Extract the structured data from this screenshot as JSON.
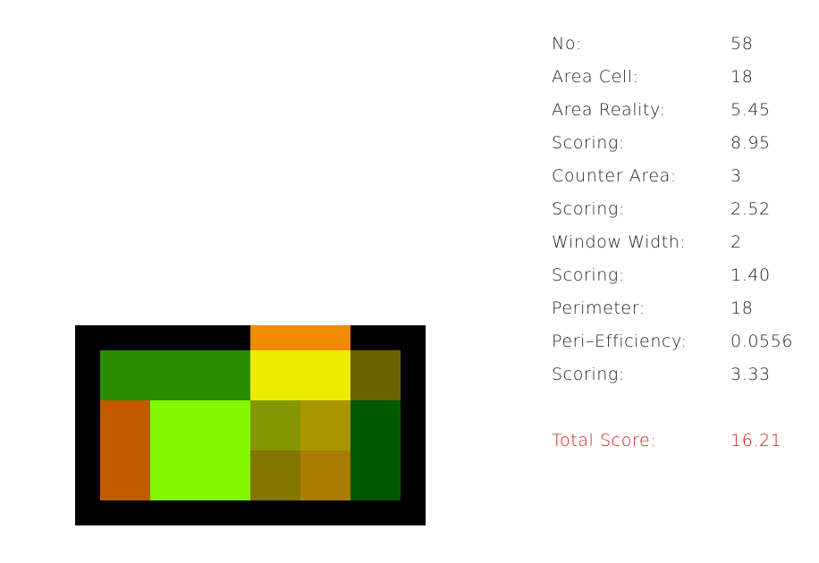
{
  "stats": [
    {
      "label": "No:",
      "value": "58"
    },
    {
      "label": "Area Cell:",
      "value": "18"
    },
    {
      "label": "Area Reality:",
      "value": "5.45"
    },
    {
      "label": "Scoring:",
      "value": "8.95"
    },
    {
      "label": "Counter Area:",
      "value": "3"
    },
    {
      "label": "Scoring:",
      "value": "2.52"
    },
    {
      "label": "Window Width:",
      "value": "2"
    },
    {
      "label": "Scoring:",
      "value": "1.40"
    },
    {
      "label": "Perimeter:",
      "value": "18"
    },
    {
      "label": "Peri–Efficiency:",
      "value": "0.0556"
    },
    {
      "label": "Scoring:",
      "value": "3.33"
    }
  ],
  "total": {
    "label": "Total Score:",
    "value": "16.21"
  },
  "colors": {
    "wall": "#000000",
    "window": "#f08a00",
    "green_dark": "#2b8c00",
    "yellow": "#ecec00",
    "olive_dark": "#6a6000",
    "orange_brown": "#c25a00",
    "lime": "#84f600",
    "olive": "#849600",
    "mustard": "#a89600",
    "olive_brown": "#847400",
    "ochre": "#a87c00",
    "forest": "#005800",
    "total_text": "#d11515"
  }
}
